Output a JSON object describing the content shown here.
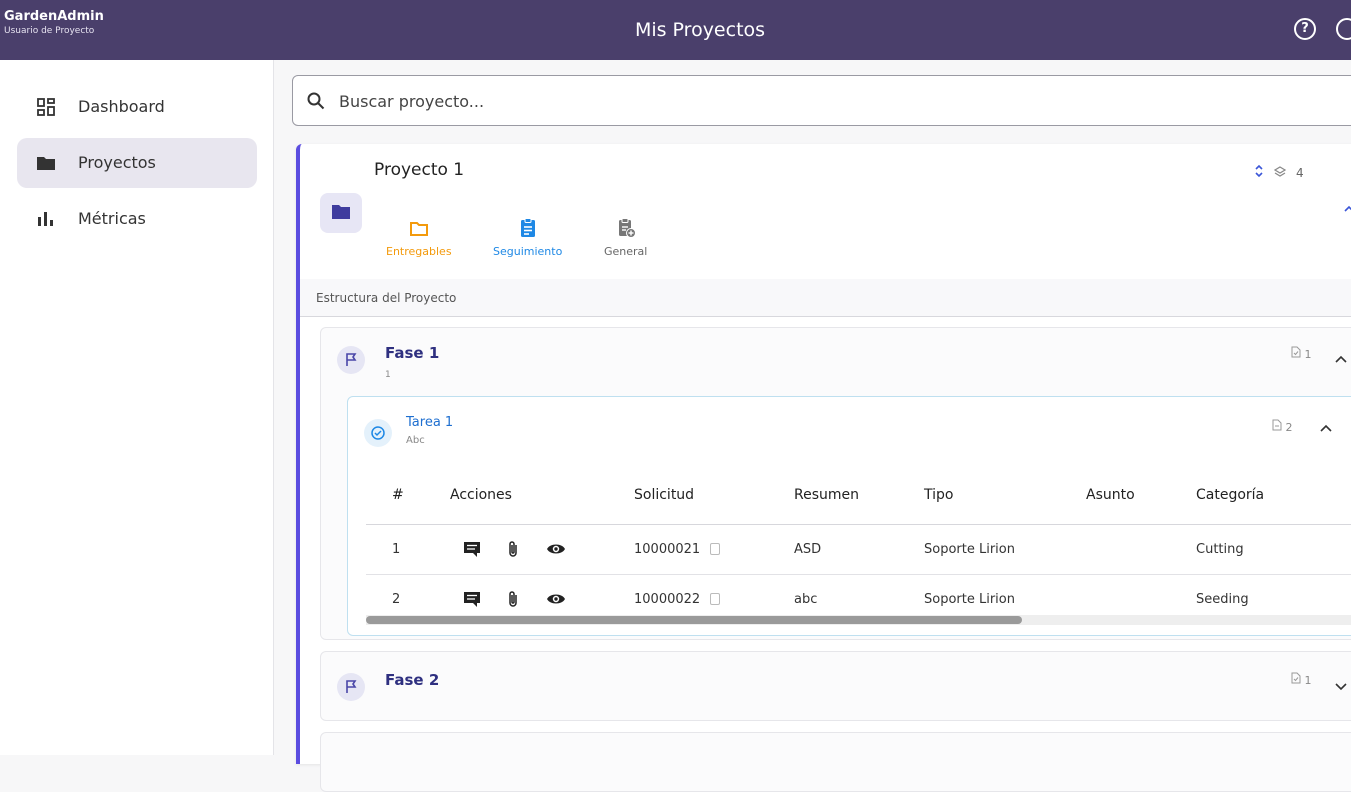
{
  "app": {
    "brand_name": "GardenAdmin",
    "brand_sub": "Usuario de Proyecto",
    "page_title": "Mis Proyectos",
    "help_symbol": "?"
  },
  "sidebar": {
    "items": [
      {
        "label": "Dashboard",
        "icon": "dashboard-icon",
        "active": false
      },
      {
        "label": "Proyectos",
        "icon": "folder-icon",
        "active": true
      },
      {
        "label": "Métricas",
        "icon": "bar-chart-icon",
        "active": false
      }
    ]
  },
  "search": {
    "placeholder": "Buscar proyecto..."
  },
  "project": {
    "title": "Proyecto 1",
    "count": "4",
    "modules": [
      {
        "label": "Entregables",
        "icon": "folder-outline-icon",
        "color": "#f39a0c"
      },
      {
        "label": "Seguimiento",
        "icon": "clipboard-icon",
        "color": "#1e88e5"
      },
      {
        "label": "General",
        "icon": "clipboard-add-icon",
        "color": "#666666"
      }
    ],
    "structure_label": "Estructura del Proyecto",
    "phases": [
      {
        "title": "Fase 1",
        "subtitle": "1",
        "count": "1",
        "expanded": true,
        "tasks": [
          {
            "title": "Tarea 1",
            "subtitle": "Abc",
            "count": "2",
            "columns": [
              "#",
              "Acciones",
              "Solicitud",
              "Resumen",
              "Tipo",
              "Asunto",
              "Categoría"
            ],
            "rows": [
              {
                "num": "1",
                "solicitud": "10000021",
                "resumen": "ASD",
                "tipo": "Soporte Lirion",
                "asunto": "",
                "categoria": "Cutting"
              },
              {
                "num": "2",
                "solicitud": "10000022",
                "resumen": "abc",
                "tipo": "Soporte Lirion",
                "asunto": "",
                "categoria": "Seeding"
              }
            ]
          }
        ]
      },
      {
        "title": "Fase 2",
        "count": "1",
        "expanded": false
      }
    ]
  },
  "colors": {
    "topbar": "#4a3f6b",
    "accent": "#5b4de0",
    "phase_title": "#2f3080",
    "task_title": "#1e6fd0"
  }
}
